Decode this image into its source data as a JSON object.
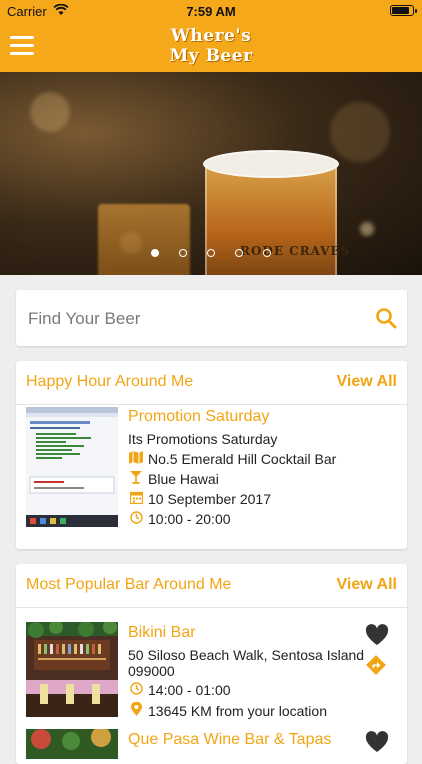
{
  "status": {
    "carrier": "Carrier",
    "time": "7:59 AM",
    "battery_level": 0.9
  },
  "header": {
    "brand_line1": "Where's",
    "brand_line2": "My Beer"
  },
  "carousel": {
    "label_text": "RODE CRAVES",
    "slide_count": 5,
    "active_index": 0
  },
  "search": {
    "placeholder": "Find Your Beer"
  },
  "happy_hour": {
    "title": "Happy Hour Around Me",
    "view_all": "View All",
    "item": {
      "title": "Promotion Saturday",
      "subtitle": "Its Promotions Saturday",
      "venue": "No.5 Emerald Hill Cocktail Bar",
      "drink": "Blue Hawai",
      "date": "10 September 2017",
      "hours": "10:00 - 20:00"
    }
  },
  "popular": {
    "title": "Most Popular Bar Around Me",
    "view_all": "View All",
    "items": [
      {
        "name": "Bikini Bar",
        "address_line1": "50 Siloso Beach Walk, Sentosa Island",
        "address_line2": "099000",
        "hours": "14:00 - 01:00",
        "distance": "13645 KM from your location"
      },
      {
        "name": "Que Pasa Wine Bar & Tapas"
      }
    ]
  },
  "colors": {
    "accent": "#f4a81a",
    "text_accent": "#f2a514",
    "background": "#eeeeee"
  },
  "icons": {
    "menu": "hamburger-icon",
    "search": "search-icon",
    "map": "map-icon",
    "drink": "cocktail-icon",
    "calendar": "calendar-icon",
    "clock": "clock-icon",
    "pin": "location-pin-icon",
    "heart": "heart-icon",
    "directions": "directions-icon"
  }
}
